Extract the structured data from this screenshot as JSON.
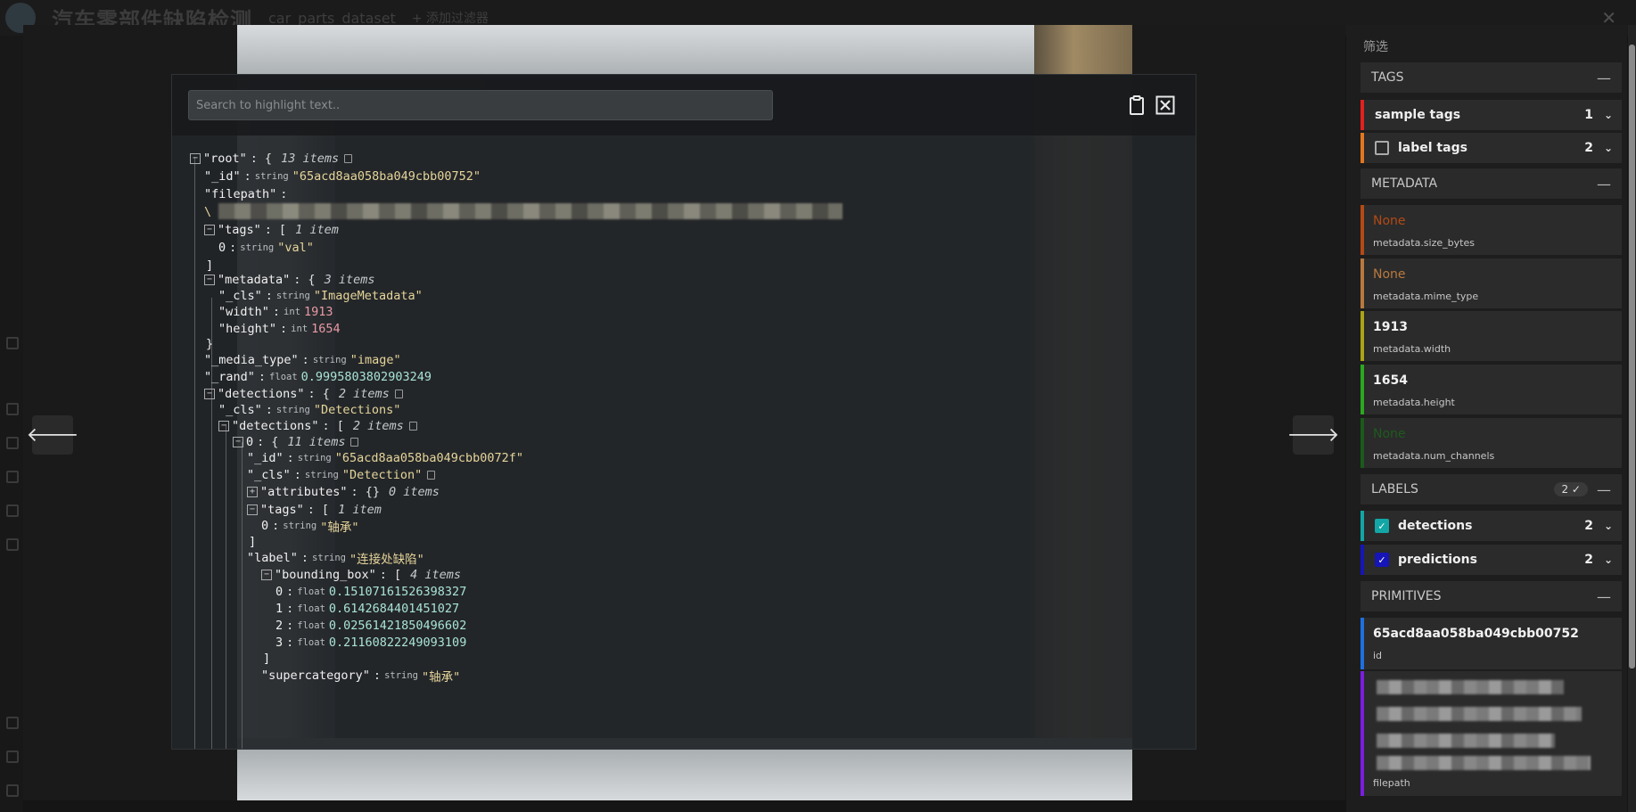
{
  "app": {
    "title": "汽车零部件缺陷检测",
    "dataset": "car_parts_dataset",
    "add_filter": "+ 添加过滤器"
  },
  "json_viewer": {
    "search_placeholder": "Search to highlight text..",
    "lines": {
      "root_key": "\"root\"",
      "root_open": "{",
      "root_count": "13 items",
      "id_key": "\"_id\"",
      "id_type": "string",
      "id_val": "\"65acd8aa058ba049cbb00752\"",
      "filepath_key": "\"filepath\"",
      "filepath_prefix": "\\",
      "tags_key": "\"tags\"",
      "tags_open": "[",
      "tags_count": "1 item",
      "tags0_idx": "0",
      "tags0_type": "string",
      "tags0_val": "\"val\"",
      "tags_close": "]",
      "metadata_key": "\"metadata\"",
      "metadata_open": "{",
      "metadata_count": "3 items",
      "md_cls_key": "\"_cls\"",
      "md_cls_type": "string",
      "md_cls_val": "\"ImageMetadata\"",
      "md_width_key": "\"width\"",
      "md_width_type": "int",
      "md_width_val": "1913",
      "md_height_key": "\"height\"",
      "md_height_type": "int",
      "md_height_val": "1654",
      "metadata_close": "}",
      "media_key": "\"_media_type\"",
      "media_type": "string",
      "media_val": "\"image\"",
      "rand_key": "\"_rand\"",
      "rand_type": "float",
      "rand_val": "0.9995803802903249",
      "det_key": "\"detections\"",
      "det_open": "{",
      "det_count": "2 items",
      "det_cls_key": "\"_cls\"",
      "det_cls_type": "string",
      "det_cls_val": "\"Detections\"",
      "dets_key": "\"detections\"",
      "dets_open": "[",
      "dets_count": "2 items",
      "d0_idx": "0",
      "d0_open": "{",
      "d0_count": "11 items",
      "d0_id_key": "\"_id\"",
      "d0_id_type": "string",
      "d0_id_val": "\"65acd8aa058ba049cbb0072f\"",
      "d0_cls_key": "\"_cls\"",
      "d0_cls_type": "string",
      "d0_cls_val": "\"Detection\"",
      "attr_key": "\"attributes\"",
      "attr_open": "{}",
      "attr_count": "0 items",
      "d0_tags_key": "\"tags\"",
      "d0_tags_open": "[",
      "d0_tags_count": "1 item",
      "d0_tags0_idx": "0",
      "d0_tags0_type": "string",
      "d0_tags0_val": "\"轴承\"",
      "d0_tags_close": "]",
      "label_key": "\"label\"",
      "label_type": "string",
      "label_val": "\"连接处缺陷\"",
      "bbox_key": "\"bounding_box\"",
      "bbox_open": "[",
      "bbox_count": "4 items",
      "bb0_idx": "0",
      "bb0_type": "float",
      "bb0_val": "0.15107161526398327",
      "bb1_idx": "1",
      "bb1_type": "float",
      "bb1_val": "0.6142684401451027",
      "bb2_idx": "2",
      "bb2_type": "float",
      "bb2_val": "0.02561421850496602",
      "bb3_idx": "3",
      "bb3_type": "float",
      "bb3_val": "0.21160822249093109",
      "bbox_close": "]",
      "super_key": "\"supercategory\"",
      "super_type": "string",
      "super_val": "\"轴承\""
    }
  },
  "sidebar": {
    "title": "筛选",
    "tags_section": "TAGS",
    "sample_tags": {
      "label": "sample tags",
      "count": "1"
    },
    "label_tags": {
      "label": "label tags",
      "count": "2"
    },
    "metadata_section": "METADATA",
    "metadata": [
      {
        "value": "None",
        "key": "metadata.size_bytes",
        "color": "#b34a15"
      },
      {
        "value": "None",
        "key": "metadata.mime_type",
        "color": "#b8793f"
      },
      {
        "value": "1913",
        "key": "metadata.width",
        "color": "#a9a517"
      },
      {
        "value": "1654",
        "key": "metadata.height",
        "color": "#2ca71f"
      },
      {
        "value": "None",
        "key": "metadata.num_channels",
        "color": "#1a5a1a"
      }
    ],
    "labels_section": "LABELS",
    "labels_pill": "2 ✓",
    "detections": {
      "label": "detections",
      "count": "2",
      "color": "#13a6a6"
    },
    "predictions": {
      "label": "predictions",
      "count": "2",
      "color": "#1515b8"
    },
    "primitives_section": "PRIMITIVES",
    "id_primitive": {
      "value": "65acd8aa058ba049cbb00752",
      "key": "id"
    },
    "filepath_primitive": {
      "key": "filepath"
    }
  },
  "colors": {
    "tags_accent": "#e32020",
    "label_tags_accent": "#e37720",
    "id_accent": "#1e6fe0",
    "filepath_accent": "#7a1ee0"
  }
}
